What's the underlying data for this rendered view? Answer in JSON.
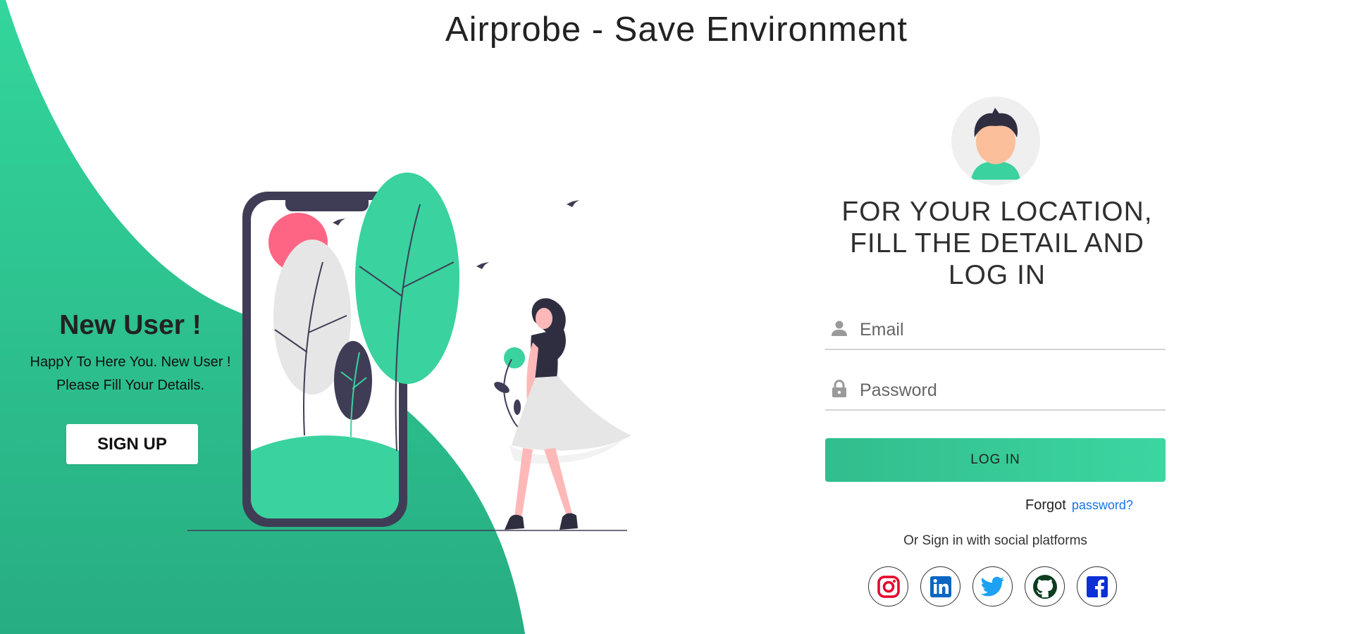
{
  "header": {
    "title": "Airprobe - Save Environment"
  },
  "colors": {
    "accent": "#2ecc8f",
    "accent_dark": "#27a57c",
    "link": "#1a73e8"
  },
  "left_panel": {
    "heading": "New User !",
    "line1": "HappY To Here You. New User !",
    "line2": "Please Fill Your Details.",
    "signup_label": "SIGN UP"
  },
  "login": {
    "title_line1": "FOR YOUR LOCATION,",
    "title_line2": "FILL THE DETAIL AND",
    "title_line3": "LOG IN",
    "email": {
      "placeholder": "Email",
      "value": "",
      "icon": "user-icon"
    },
    "password": {
      "placeholder": "Password",
      "value": "",
      "icon": "lock-icon"
    },
    "button_label": "LOG IN",
    "forgot_text": "Forgot",
    "forgot_link": "password?",
    "social_text": "Or Sign in with social platforms",
    "socials": [
      "instagram-icon",
      "linkedin-icon",
      "twitter-icon",
      "github-icon",
      "facebook-icon"
    ]
  }
}
